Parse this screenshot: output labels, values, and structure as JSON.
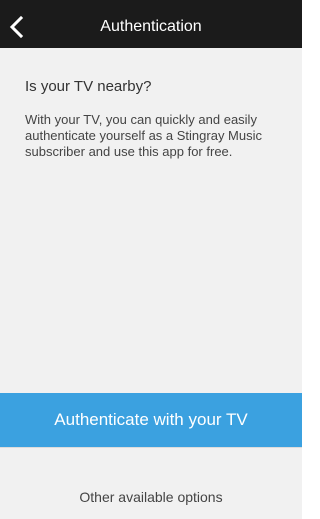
{
  "nav": {
    "title": "Authentication",
    "back_icon": "chevron-left-icon"
  },
  "main": {
    "heading": "Is your TV nearby?",
    "description": "With your TV, you can quickly and easily authenticate yourself as a Stingray Music subscriber and use this app for free."
  },
  "actions": {
    "primary_label": "Authenticate with your TV",
    "secondary_label": "Other available options"
  },
  "colors": {
    "nav_background": "#1b1b1b",
    "content_background": "#f1f1f1",
    "accent": "#3ba1e0"
  }
}
